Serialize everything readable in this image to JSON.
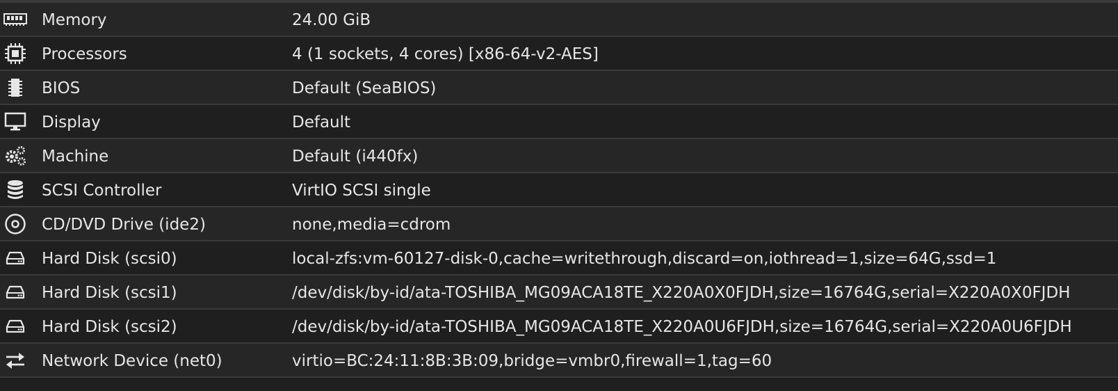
{
  "rows": [
    {
      "label": "Memory",
      "value": "24.00 GiB",
      "icon": "memory-icon"
    },
    {
      "label": "Processors",
      "value": "4 (1 sockets, 4 cores) [x86-64-v2-AES]",
      "icon": "cpu-icon"
    },
    {
      "label": "BIOS",
      "value": "Default (SeaBIOS)",
      "icon": "bios-chip-icon"
    },
    {
      "label": "Display",
      "value": "Default",
      "icon": "monitor-icon"
    },
    {
      "label": "Machine",
      "value": "Default (i440fx)",
      "icon": "gears-icon"
    },
    {
      "label": "SCSI Controller",
      "value": "VirtIO SCSI single",
      "icon": "database-icon"
    },
    {
      "label": "CD/DVD Drive (ide2)",
      "value": "none,media=cdrom",
      "icon": "cd-icon"
    },
    {
      "label": "Hard Disk (scsi0)",
      "value": "local-zfs:vm-60127-disk-0,cache=writethrough,discard=on,iothread=1,size=64G,ssd=1",
      "icon": "hard-disk-icon"
    },
    {
      "label": "Hard Disk (scsi1)",
      "value": "/dev/disk/by-id/ata-TOSHIBA_MG09ACA18TE_X220A0X0FJDH,size=16764G,serial=X220A0X0FJDH",
      "icon": "hard-disk-icon"
    },
    {
      "label": "Hard Disk (scsi2)",
      "value": "/dev/disk/by-id/ata-TOSHIBA_MG09ACA18TE_X220A0U6FJDH,size=16764G,serial=X220A0U6FJDH",
      "icon": "hard-disk-icon"
    },
    {
      "label": "Network Device (net0)",
      "value": "virtio=BC:24:11:8B:3B:09,bridge=vmbr0,firewall=1,tag=60",
      "icon": "exchange-arrows-icon"
    }
  ]
}
